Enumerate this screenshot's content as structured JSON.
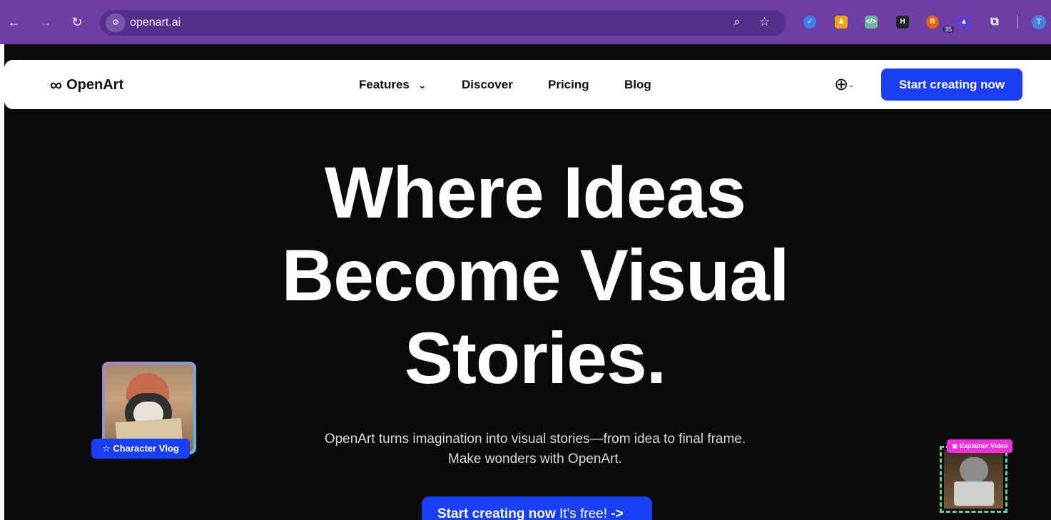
{
  "browser": {
    "url": "openart.ai",
    "profile_initial": "T",
    "extension_badge": "35"
  },
  "nav": {
    "logo_icon": "∞",
    "logo_text": "OpenArt",
    "links": [
      {
        "label": "Features",
        "has_dropdown": true
      },
      {
        "label": "Discover"
      },
      {
        "label": "Pricing"
      },
      {
        "label": "Blog"
      }
    ],
    "cta_label": "Start creating now"
  },
  "hero": {
    "title_line1": "Where Ideas",
    "title_line2": "Become Visual",
    "title_line3": "Stories.",
    "subtitle_line1": "OpenArt turns imagination into visual stories—from idea to final frame.",
    "subtitle_line2": "Make wonders with OpenArt.",
    "cta_bold": "Start creating now",
    "cta_light": "It's free!",
    "cta_arrow": "->"
  },
  "cards": {
    "character_vlog": "☆ Character Vlog",
    "explainer_video": "▣ Explainer Video"
  },
  "colors": {
    "chrome": "#6d3ea3",
    "accent": "#1a3ef2",
    "page_bg": "#0a0a0a",
    "explainer_tag": "#ef2fd8"
  }
}
